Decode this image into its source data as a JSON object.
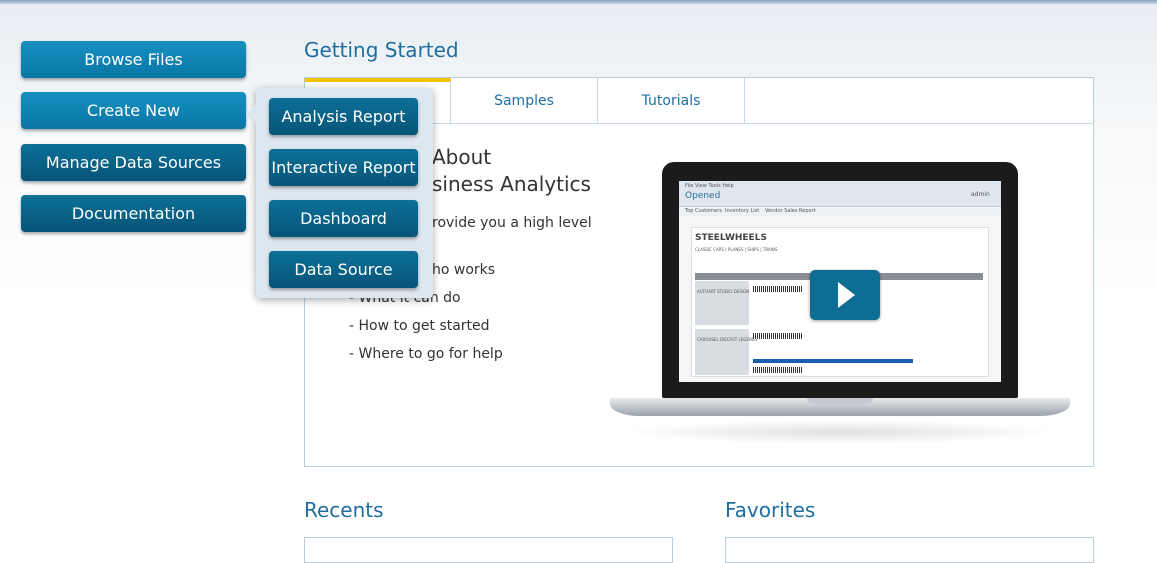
{
  "nav": {
    "browse_files": "Browse Files",
    "create_new": "Create New",
    "manage_data_sources": "Manage Data Sources",
    "documentation": "Documentation"
  },
  "create_menu": {
    "analysis_report": "Analysis Report",
    "interactive_report": "Interactive Report",
    "dashboard": "Dashboard",
    "data_source": "Data Source"
  },
  "getting_started": {
    "title": "Getting Started",
    "tabs": [
      "",
      "Samples",
      "Tutorials"
    ],
    "about_title_line1": "About",
    "about_title_line2": "siness Analytics",
    "intro_line1": "rovide you a high level",
    "bullets": [
      "ho works",
      "- What it can do",
      "- How to get started",
      "- Where to go for help"
    ]
  },
  "video": {
    "play_icon": "play-icon",
    "screen_app_menu": "File   View   Tools   Help",
    "screen_opened": "Opened",
    "screen_user": "admin",
    "screen_tabs": [
      "Top Customers",
      "Inventory List",
      "Vendor Sales Report"
    ],
    "screen_title": "STEELWHEELS",
    "screen_subtitle": "CLASSIC CARS  |  PLANES  |  SHIPS  |  TRAINS",
    "screen_rows": [
      "AUTOART STUDIO DESIGN",
      "CAROUSEL DIECAST LEGENDS"
    ]
  },
  "recents": {
    "title": "Recents"
  },
  "favorites": {
    "title": "Favorites"
  }
}
